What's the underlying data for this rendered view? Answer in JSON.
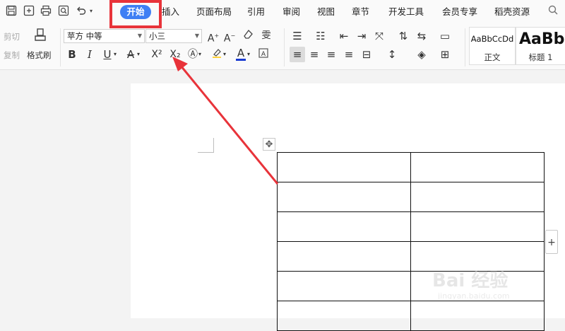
{
  "menubar": {
    "quick_access": [
      {
        "name": "save-icon",
        "glyph": "🖫"
      },
      {
        "name": "export-icon",
        "glyph": "⎘"
      },
      {
        "name": "print-icon",
        "glyph": "⎙"
      },
      {
        "name": "print-preview-icon",
        "glyph": "🔍"
      },
      {
        "name": "undo-icon",
        "glyph": "↶"
      }
    ],
    "tabs": [
      "开始",
      "插入",
      "页面布局",
      "引用",
      "审阅",
      "视图",
      "章节",
      "开发工具",
      "会员专享",
      "稻壳资源"
    ],
    "active_tab": "开始",
    "search_glyph": "Q"
  },
  "ribbon": {
    "cut_label": "剪切",
    "copy_label": "复制",
    "format_painter_label": "格式刷",
    "font_name": "苹方 中等",
    "font_size": "小三",
    "bold": "B",
    "italic": "I",
    "underline": "U",
    "strikethrough": "A",
    "superscript": "X²",
    "subscript": "X₂",
    "font_color_glyph": "A",
    "styles": [
      {
        "sample": "AaBbCcDd",
        "name": "正文"
      },
      {
        "sample": "AaBb",
        "name": "标题 1"
      }
    ]
  },
  "document": {
    "table_rows": 6,
    "table_cols": 2,
    "move_handle_glyph": "✥",
    "add_column_glyph": "+"
  },
  "watermark": {
    "text": "Bai 经验",
    "url": "jingyan.baidu.com"
  },
  "colors": {
    "accent": "#3f7ff4",
    "annotation_red": "#e8333a"
  }
}
